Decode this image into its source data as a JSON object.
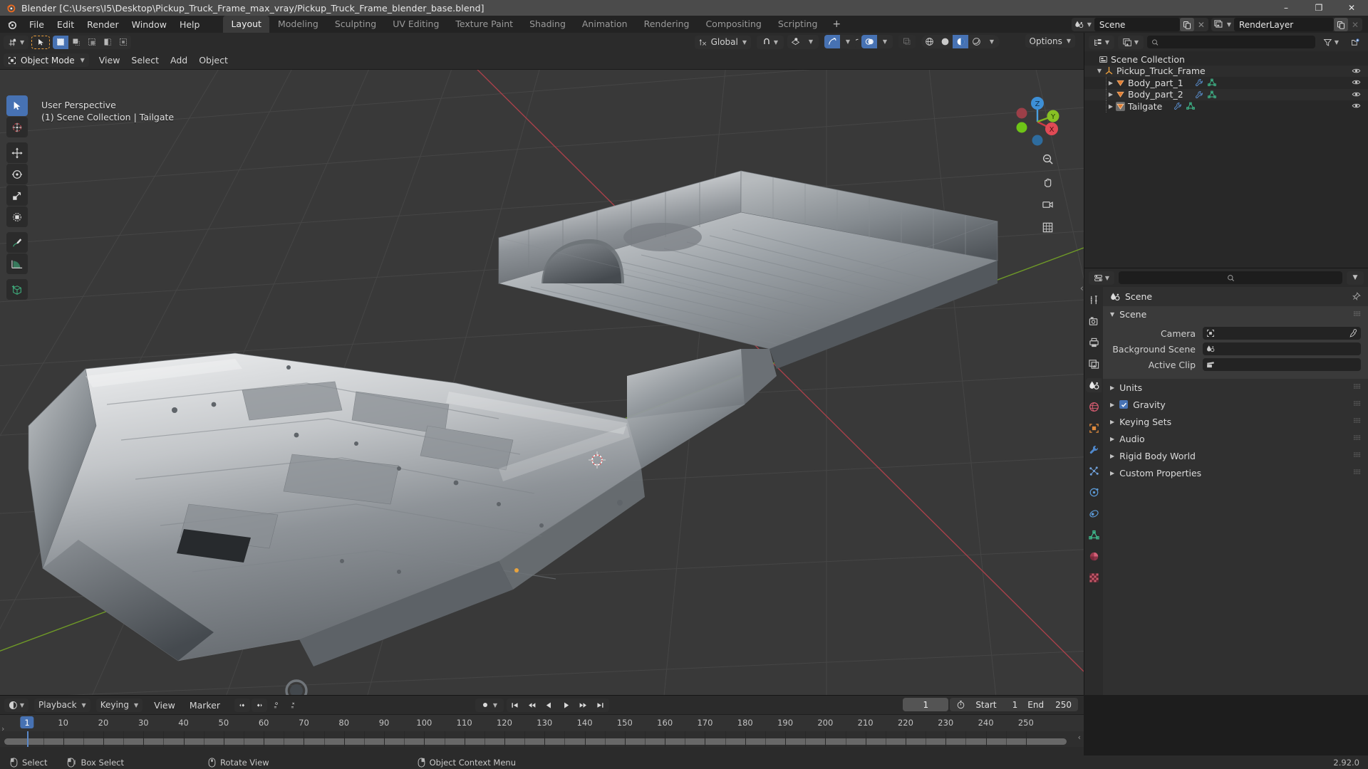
{
  "window": {
    "title": "Blender [C:\\Users\\I5\\Desktop\\Pickup_Truck_Frame_max_vray/Pickup_Truck_Frame_blender_base.blend]",
    "minimize": "–",
    "maximize": "❐",
    "close": "✕"
  },
  "topbar": {
    "menus": [
      "File",
      "Edit",
      "Render",
      "Window",
      "Help"
    ],
    "workspaces": [
      "Layout",
      "Modeling",
      "Sculpting",
      "UV Editing",
      "Texture Paint",
      "Shading",
      "Animation",
      "Rendering",
      "Compositing",
      "Scripting"
    ],
    "active_workspace": "Layout",
    "add_workspace": "+",
    "scene_name": "Scene",
    "viewlayer_name": "RenderLayer"
  },
  "viewport": {
    "mode": "Object Mode",
    "menus": [
      "View",
      "Select",
      "Add",
      "Object"
    ],
    "transform_orientation": "Global",
    "options_label": "Options",
    "info_line1": "User Perspective",
    "info_line2": "(1) Scene Collection | Tailgate",
    "gizmo_axes": {
      "x": "X",
      "y": "Y",
      "z": "Z"
    },
    "tools": [
      "tweak-select-tool",
      "cursor-tool",
      "move-tool",
      "rotate-tool",
      "scale-tool",
      "transform-tool",
      "annotate-tool",
      "measure-tool",
      "add-cube-tool"
    ],
    "nav_tools": [
      "zoom-tool",
      "pan-tool",
      "camera-view-tool",
      "toggle-ortho-tool"
    ]
  },
  "outliner": {
    "search_placeholder": "",
    "rows": [
      {
        "label": "Scene Collection",
        "icon": "collection-icon",
        "indent": 0,
        "expand": "",
        "eye": false
      },
      {
        "label": "Pickup_Truck_Frame",
        "icon": "empty-axis-icon",
        "indent": 1,
        "expand": "▼",
        "eye": true
      },
      {
        "label": "Body_part_1",
        "icon": "mesh-data-icon",
        "indent": 2,
        "expand": "▶",
        "eye": true
      },
      {
        "label": "Body_part_2",
        "icon": "mesh-data-icon",
        "indent": 2,
        "expand": "▶",
        "eye": true
      },
      {
        "label": "Tailgate",
        "icon": "mesh-data-icon",
        "indent": 2,
        "expand": "▶",
        "eye": true
      }
    ]
  },
  "properties": {
    "breadcrumb": "Scene",
    "panels": [
      {
        "label": "Scene",
        "open": true
      },
      {
        "label": "Units",
        "open": false
      },
      {
        "label": "Gravity",
        "open": false,
        "checkbox": true
      },
      {
        "label": "Keying Sets",
        "open": false
      },
      {
        "label": "Audio",
        "open": false
      },
      {
        "label": "Rigid Body World",
        "open": false
      },
      {
        "label": "Custom Properties",
        "open": false
      }
    ],
    "scene_fields": [
      {
        "label": "Camera",
        "value": "",
        "icon": "camera-icon",
        "eyedropper": true
      },
      {
        "label": "Background Scene",
        "value": "",
        "icon": "scene-icon",
        "eyedropper": false
      },
      {
        "label": "Active Clip",
        "value": "",
        "icon": "clip-icon",
        "eyedropper": false
      }
    ],
    "tabs": [
      "tool-tab",
      "render-tab",
      "output-tab",
      "view-layer-tab",
      "scene-tab",
      "world-tab",
      "object-tab",
      "modifier-tab",
      "particles-tab",
      "physics-tab",
      "constraints-tab",
      "object-data-tab",
      "material-tab",
      "texture-tab"
    ],
    "active_tab": "scene-tab"
  },
  "timeline": {
    "menus": [
      "Playback",
      "Keying",
      "View",
      "Marker"
    ],
    "current_frame": "1",
    "start_label": "Start",
    "start_value": "1",
    "end_label": "End",
    "end_value": "250",
    "ticks": [
      "10",
      "20",
      "30",
      "40",
      "50",
      "60",
      "70",
      "80",
      "90",
      "100",
      "110",
      "120",
      "130",
      "140",
      "150",
      "160",
      "170",
      "180",
      "190",
      "200",
      "210",
      "220",
      "230",
      "240",
      "250"
    ],
    "tick_values": [
      10,
      20,
      30,
      40,
      50,
      60,
      70,
      80,
      90,
      100,
      110,
      120,
      130,
      140,
      150,
      160,
      170,
      180,
      190,
      200,
      210,
      220,
      230,
      240,
      250
    ],
    "range_min": 1,
    "range_max": 255
  },
  "statusbar": {
    "items": [
      {
        "icon": "mouse-left-icon",
        "label": "Select"
      },
      {
        "icon": "mouse-left-drag-icon",
        "label": "Box Select"
      },
      {
        "icon": "mouse-middle-icon",
        "label": "Rotate View"
      },
      {
        "icon": "mouse-right-icon",
        "label": "Object Context Menu"
      }
    ],
    "version": "2.92.0"
  },
  "colors": {
    "accent": "#4772b3",
    "header": "#2b2b2b",
    "panel": "#303030",
    "viewport_bg": "#393939",
    "title_bar": "#4b4b4b",
    "axis_x": "#cc3b47",
    "axis_y": "#7fb41f",
    "orange": "#e79c3c"
  }
}
